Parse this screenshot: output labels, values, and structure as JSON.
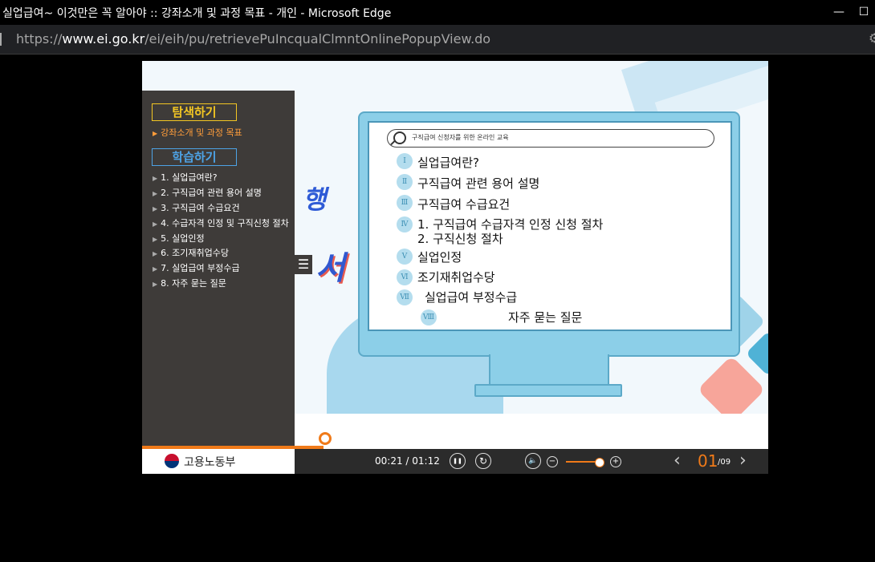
{
  "window": {
    "title": "실업급여~ 이것만은 꼭 알아야 :: 강좌소개 및 과정 목표 - 개인 - Microsoft Edge",
    "minimize_glyph": "—",
    "maximize_glyph": "☐"
  },
  "address": {
    "url_prefix": "https://",
    "url_host": "www.ei.go.kr",
    "url_path": "/ei/eih/pu/retrievePuIncqualClmntOnlinePopupView.do",
    "settings_icon": "⚙"
  },
  "sidebar": {
    "explore_heading": "탐색하기",
    "explore_items": [
      {
        "label": "강좌소개 및 과정 목표",
        "active": true
      }
    ],
    "learn_heading": "학습하기",
    "learn_items": [
      {
        "label": "1. 실업급여란?"
      },
      {
        "label": "2. 구직급여 관련 용어 설명"
      },
      {
        "label": "3. 구직급여 수급요건"
      },
      {
        "label": "4. 수급자격 인정 및 구직신청 절차"
      },
      {
        "label": "5. 실업인정"
      },
      {
        "label": "6. 조기재취업수당"
      },
      {
        "label": "7. 실업급여 부정수급"
      },
      {
        "label": "8. 자주 묻는 질문"
      }
    ],
    "arrow": "▶",
    "toggle_glyph": "☰"
  },
  "slide": {
    "search_text": "구직급여 신청자를 위한 온라인 교육",
    "toc": [
      {
        "num": "Ⅰ",
        "text": "실업급여란?"
      },
      {
        "num": "Ⅱ",
        "text": "구직급여 관련 용어 설명"
      },
      {
        "num": "Ⅲ",
        "text": "구직급여 수급요건"
      },
      {
        "num": "Ⅳ",
        "text": "1. 구직급여 수급자격 인정 신청 절차",
        "text2": "2. 구직신청 절차"
      },
      {
        "num": "Ⅴ",
        "text": "실업인정"
      },
      {
        "num": "Ⅵ",
        "text": "조기재취업수당"
      },
      {
        "num": "Ⅶ",
        "text": "실업급여 부정수급"
      },
      {
        "num": "Ⅷ",
        "text": "자주 묻는 질문"
      }
    ],
    "decor_text_1": "행",
    "decor_text_2": "서"
  },
  "player": {
    "logo_name": "고용노동부",
    "time": "00:21 / 01:12",
    "pause_glyph": "❚❚",
    "replay_glyph": "↻",
    "volume_glyph": "🔈",
    "vol_minus_glyph": "−",
    "vol_plus_glyph": "+",
    "progress": 0.29,
    "volume_level": 0.85,
    "prev_glyph": "‹",
    "next_glyph": "›",
    "page_current": "01",
    "page_total": "/09"
  },
  "colors": {
    "accent": "#f07a19",
    "sidebar_bg": "#3e3b39",
    "explore_heading": "#f3c623",
    "learn_heading": "#4da3e6",
    "monitor": "#8ccfe8"
  }
}
